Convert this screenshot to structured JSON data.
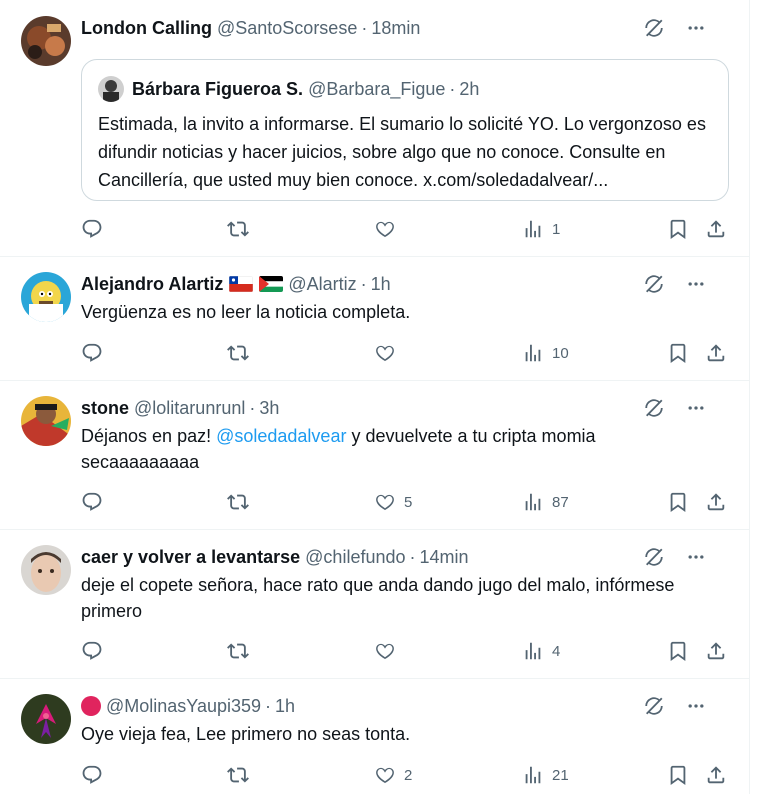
{
  "posts": [
    {
      "name": "London Calling",
      "handle": "@SantoScorsese",
      "time": "18min",
      "text": "",
      "quote": {
        "name": "Bárbara Figueroa S.",
        "handle": "@Barbara_Figue",
        "time": "2h",
        "text": "Estimada, la invito a informarse. El sumario lo solicité YO. Lo vergonzoso es difundir noticias y hacer juicios, sobre algo que no conoce. Consulte en Cancillería, que usted muy bien conoce. x.com/soledadalvear/..."
      },
      "likes": "",
      "views": "1"
    },
    {
      "name": "Alejandro Alartiz",
      "handle": "@Alartiz",
      "time": "1h",
      "text": "Vergüenza es no leer la noticia completa.",
      "likes": "",
      "views": "10"
    },
    {
      "name": "stone",
      "handle": "@lolitarunrunl",
      "time": "3h",
      "text_before": "Déjanos en paz! ",
      "mention": "@soledadalvear",
      "text_after": " y  devuelvete a tu cripta momia secaaaaaaaaa",
      "likes": "5",
      "views": "87"
    },
    {
      "name": "caer y volver a levantarse",
      "handle": "@chilefundo",
      "time": "14min",
      "text": "deje el copete señora, hace rato que anda dando jugo del malo, infórmese primero",
      "likes": "",
      "views": "4"
    },
    {
      "name": "",
      "handle": "@MolinasYaupi359",
      "time": "1h",
      "text": "Oye vieja fea, Lee primero no seas tonta.",
      "likes": "2",
      "views": "21"
    }
  ],
  "separator": "·",
  "colors": {
    "text": "#0f1419",
    "secondary": "#536471",
    "link": "#1d9bf0",
    "border": "#eff3f4",
    "red_circle": "#e0245e"
  },
  "icons": [
    "grok-icon",
    "more-icon",
    "reply-icon",
    "retweet-icon",
    "like-icon",
    "views-icon",
    "bookmark-icon",
    "share-icon"
  ]
}
